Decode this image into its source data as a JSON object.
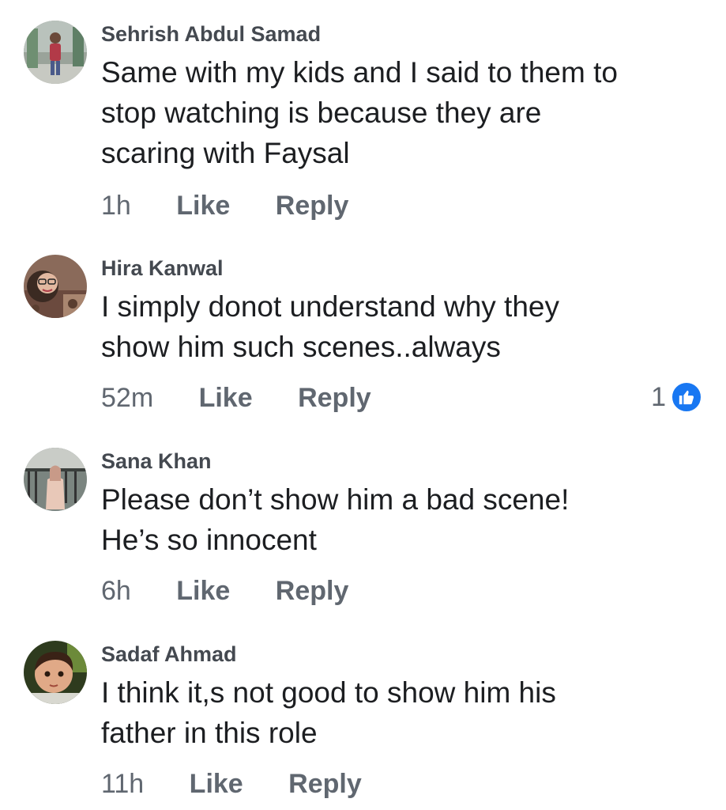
{
  "comments": [
    {
      "author": "Sehrish Abdul Samad",
      "lines": [
        "Same with my kids and I said to them to",
        "stop watching is because they are",
        "scaring with Faysal"
      ],
      "time": "1h",
      "like_label": "Like",
      "reply_label": "Reply"
    },
    {
      "author": "Hira Kanwal",
      "lines": [
        "I simply donot understand why they",
        "show him such scenes..always"
      ],
      "time": "52m",
      "like_label": "Like",
      "reply_label": "Reply",
      "reaction_count": "1",
      "reaction_icon": "thumbs-up-icon"
    },
    {
      "author": "Sana Khan",
      "lines": [
        "Please don’t show him a bad scene!",
        "He’s so innocent"
      ],
      "time": "6h",
      "like_label": "Like",
      "reply_label": "Reply"
    },
    {
      "author": "Sadaf Ahmad",
      "lines": [
        "I think it,s not good to show him his",
        "father in this role"
      ],
      "time": "11h",
      "like_label": "Like",
      "reply_label": "Reply"
    }
  ],
  "colors": {
    "author": "#444950",
    "text": "#1c1e21",
    "action": "#606770",
    "like_badge": "#1877f2"
  }
}
